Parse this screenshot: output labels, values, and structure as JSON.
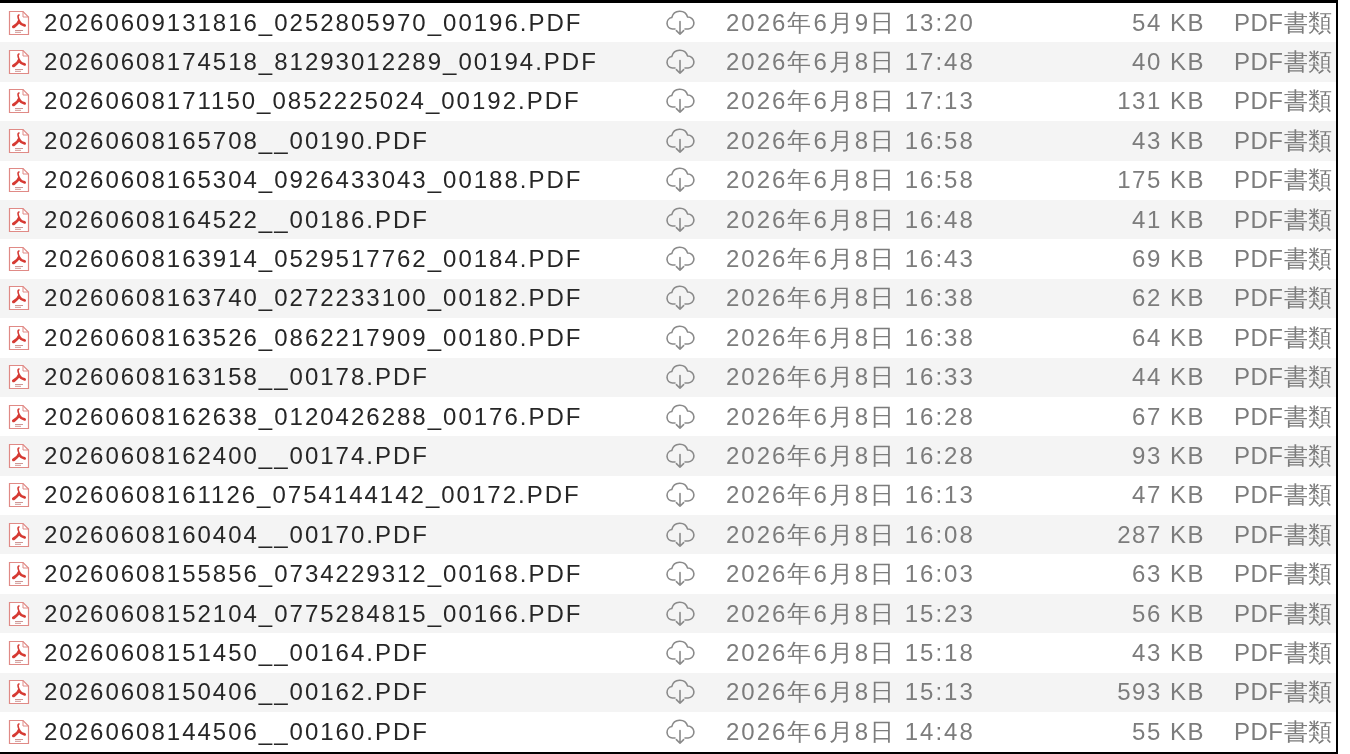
{
  "file_list": {
    "rows": [
      [
        "20260609131816_0252805970_00196.PDF",
        "2026年6月9日 13:20",
        "54 KB",
        "PDF書類"
      ],
      [
        "20260608174518_81293012289_00194.PDF",
        "2026年6月8日 17:48",
        "40 KB",
        "PDF書類"
      ],
      [
        "20260608171150_0852225024_00192.PDF",
        "2026年6月8日 17:13",
        "131 KB",
        "PDF書類"
      ],
      [
        "20260608165708__00190.PDF",
        "2026年6月8日 16:58",
        "43 KB",
        "PDF書類"
      ],
      [
        "20260608165304_0926433043_00188.PDF",
        "2026年6月8日 16:58",
        "175 KB",
        "PDF書類"
      ],
      [
        "20260608164522__00186.PDF",
        "2026年6月8日 16:48",
        "41 KB",
        "PDF書類"
      ],
      [
        "20260608163914_0529517762_00184.PDF",
        "2026年6月8日 16:43",
        "69 KB",
        "PDF書類"
      ],
      [
        "20260608163740_0272233100_00182.PDF",
        "2026年6月8日 16:38",
        "62 KB",
        "PDF書類"
      ],
      [
        "20260608163526_0862217909_00180.PDF",
        "2026年6月8日 16:38",
        "64 KB",
        "PDF書類"
      ],
      [
        "20260608163158__00178.PDF",
        "2026年6月8日 16:33",
        "44 KB",
        "PDF書類"
      ],
      [
        "20260608162638_0120426288_00176.PDF",
        "2026年6月8日 16:28",
        "67 KB",
        "PDF書類"
      ],
      [
        "20260608162400__00174.PDF",
        "2026年6月8日 16:28",
        "93 KB",
        "PDF書類"
      ],
      [
        "20260608161126_0754144142_00172.PDF",
        "2026年6月8日 16:13",
        "47 KB",
        "PDF書類"
      ],
      [
        "20260608160404__00170.PDF",
        "2026年6月8日 16:08",
        "287 KB",
        "PDF書類"
      ],
      [
        "20260608155856_0734229312_00168.PDF",
        "2026年6月8日 16:03",
        "63 KB",
        "PDF書類"
      ],
      [
        "20260608152104_0775284815_00166.PDF",
        "2026年6月8日 15:23",
        "56 KB",
        "PDF書類"
      ],
      [
        "20260608151450__00164.PDF",
        "2026年6月8日 15:18",
        "43 KB",
        "PDF書類"
      ],
      [
        "20260608150406__00162.PDF",
        "2026年6月8日 15:13",
        "593 KB",
        "PDF書類"
      ],
      [
        "20260608144506__00160.PDF",
        "2026年6月8日 14:48",
        "55 KB",
        "PDF書類"
      ]
    ]
  }
}
